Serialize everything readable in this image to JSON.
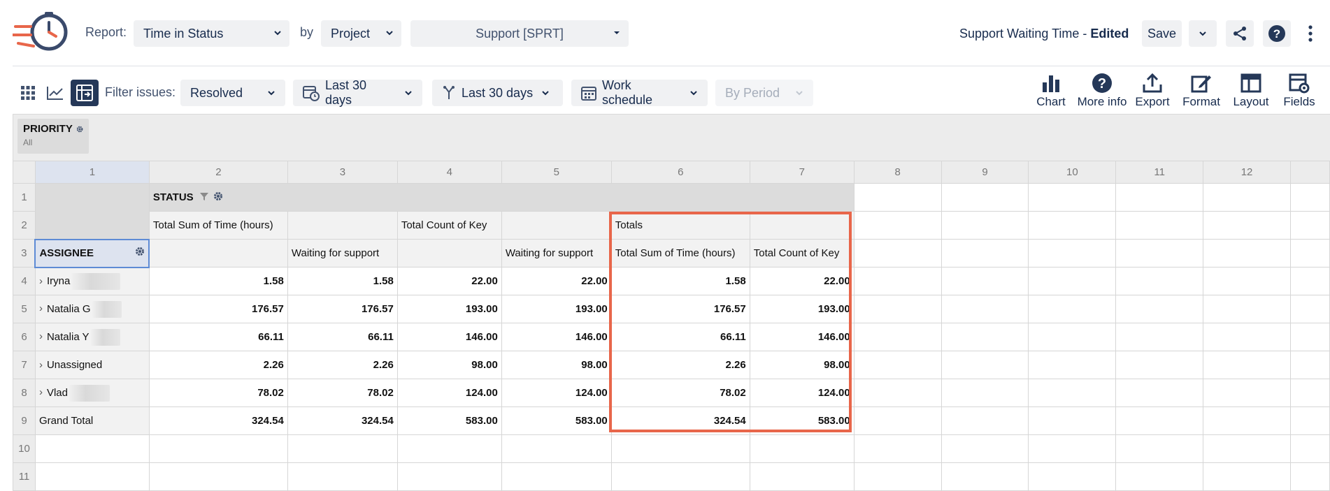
{
  "header": {
    "report_label": "Report:",
    "report_value": "Time in Status",
    "by_label": "by",
    "by_value": "Project",
    "project_value": "Support [SPRT]",
    "title_name": "Support Waiting Time - ",
    "title_state": "Edited",
    "save_label": "Save"
  },
  "toolbar": {
    "filter_label": "Filter issues:",
    "filter_value": "Resolved",
    "date_range_1": "Last 30 days",
    "date_range_2": "Last 30 days",
    "schedule": "Work schedule",
    "by_period": "By Period",
    "tools": [
      "Chart",
      "More info",
      "Export",
      "Format",
      "Layout",
      "Fields"
    ]
  },
  "priority_chip": {
    "title": "PRIORITY",
    "subtitle": "All"
  },
  "grid": {
    "col_headers": [
      "1",
      "2",
      "3",
      "4",
      "5",
      "6",
      "7",
      "8",
      "9",
      "10",
      "11",
      "12",
      ""
    ],
    "row_headers": [
      "1",
      "2",
      "3",
      "4",
      "5",
      "6",
      "7",
      "8",
      "9",
      "10",
      "11"
    ],
    "status_label": "STATUS",
    "row2": [
      "Total Sum of Time (hours)",
      "",
      "Total Count of Key",
      "",
      "Totals",
      ""
    ],
    "row3": [
      "ASSIGNEE",
      "",
      "Waiting for support",
      "",
      "Waiting for support",
      "Total Sum of Time (hours)",
      "Total Count of Key"
    ],
    "rows": [
      {
        "name": "Iryna",
        "expandable": true,
        "values": [
          "1.58",
          "1.58",
          "22.00",
          "22.00",
          "1.58",
          "22.00"
        ]
      },
      {
        "name": "Natalia G",
        "expandable": true,
        "values": [
          "176.57",
          "176.57",
          "193.00",
          "193.00",
          "176.57",
          "193.00"
        ]
      },
      {
        "name": "Natalia Y",
        "expandable": true,
        "values": [
          "66.11",
          "66.11",
          "146.00",
          "146.00",
          "66.11",
          "146.00"
        ]
      },
      {
        "name": "Unassigned",
        "expandable": true,
        "values": [
          "2.26",
          "2.26",
          "98.00",
          "98.00",
          "2.26",
          "98.00"
        ]
      },
      {
        "name": "Vlad",
        "expandable": true,
        "values": [
          "78.02",
          "78.02",
          "124.00",
          "124.00",
          "78.02",
          "124.00"
        ]
      },
      {
        "name": "Grand Total",
        "expandable": false,
        "values": [
          "324.54",
          "324.54",
          "583.00",
          "583.00",
          "324.54",
          "583.00"
        ]
      }
    ]
  },
  "colors": {
    "highlight": "#e8664a",
    "active_view": "#253858",
    "selection": "#5e8bd5"
  }
}
